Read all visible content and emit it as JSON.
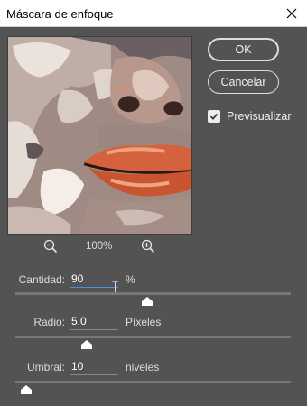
{
  "dialog": {
    "title": "Máscara de enfoque"
  },
  "buttons": {
    "ok": "OK",
    "cancel": "Cancelar"
  },
  "preview_toggle": {
    "label": "Previsualizar",
    "checked": true
  },
  "zoom": {
    "value": "100%"
  },
  "params": {
    "amount": {
      "label": "Cantidad:",
      "value": "90",
      "unit": "%",
      "slider_fraction": 0.48
    },
    "radius": {
      "label": "Radio:",
      "value": "5.0",
      "unit": "Píxeles",
      "slider_fraction": 0.26
    },
    "threshold": {
      "label": "Umbral:",
      "value": "10",
      "unit": "niveles",
      "slider_fraction": 0.04
    }
  },
  "colors": {
    "panel": "#535353",
    "track": "#777777",
    "text": "#dcdcdc",
    "focus": "#4a90e2"
  },
  "icons": {
    "close": "close-icon",
    "zoom_out": "zoom-out-icon",
    "zoom_in": "zoom-in-icon",
    "check": "check-icon"
  }
}
